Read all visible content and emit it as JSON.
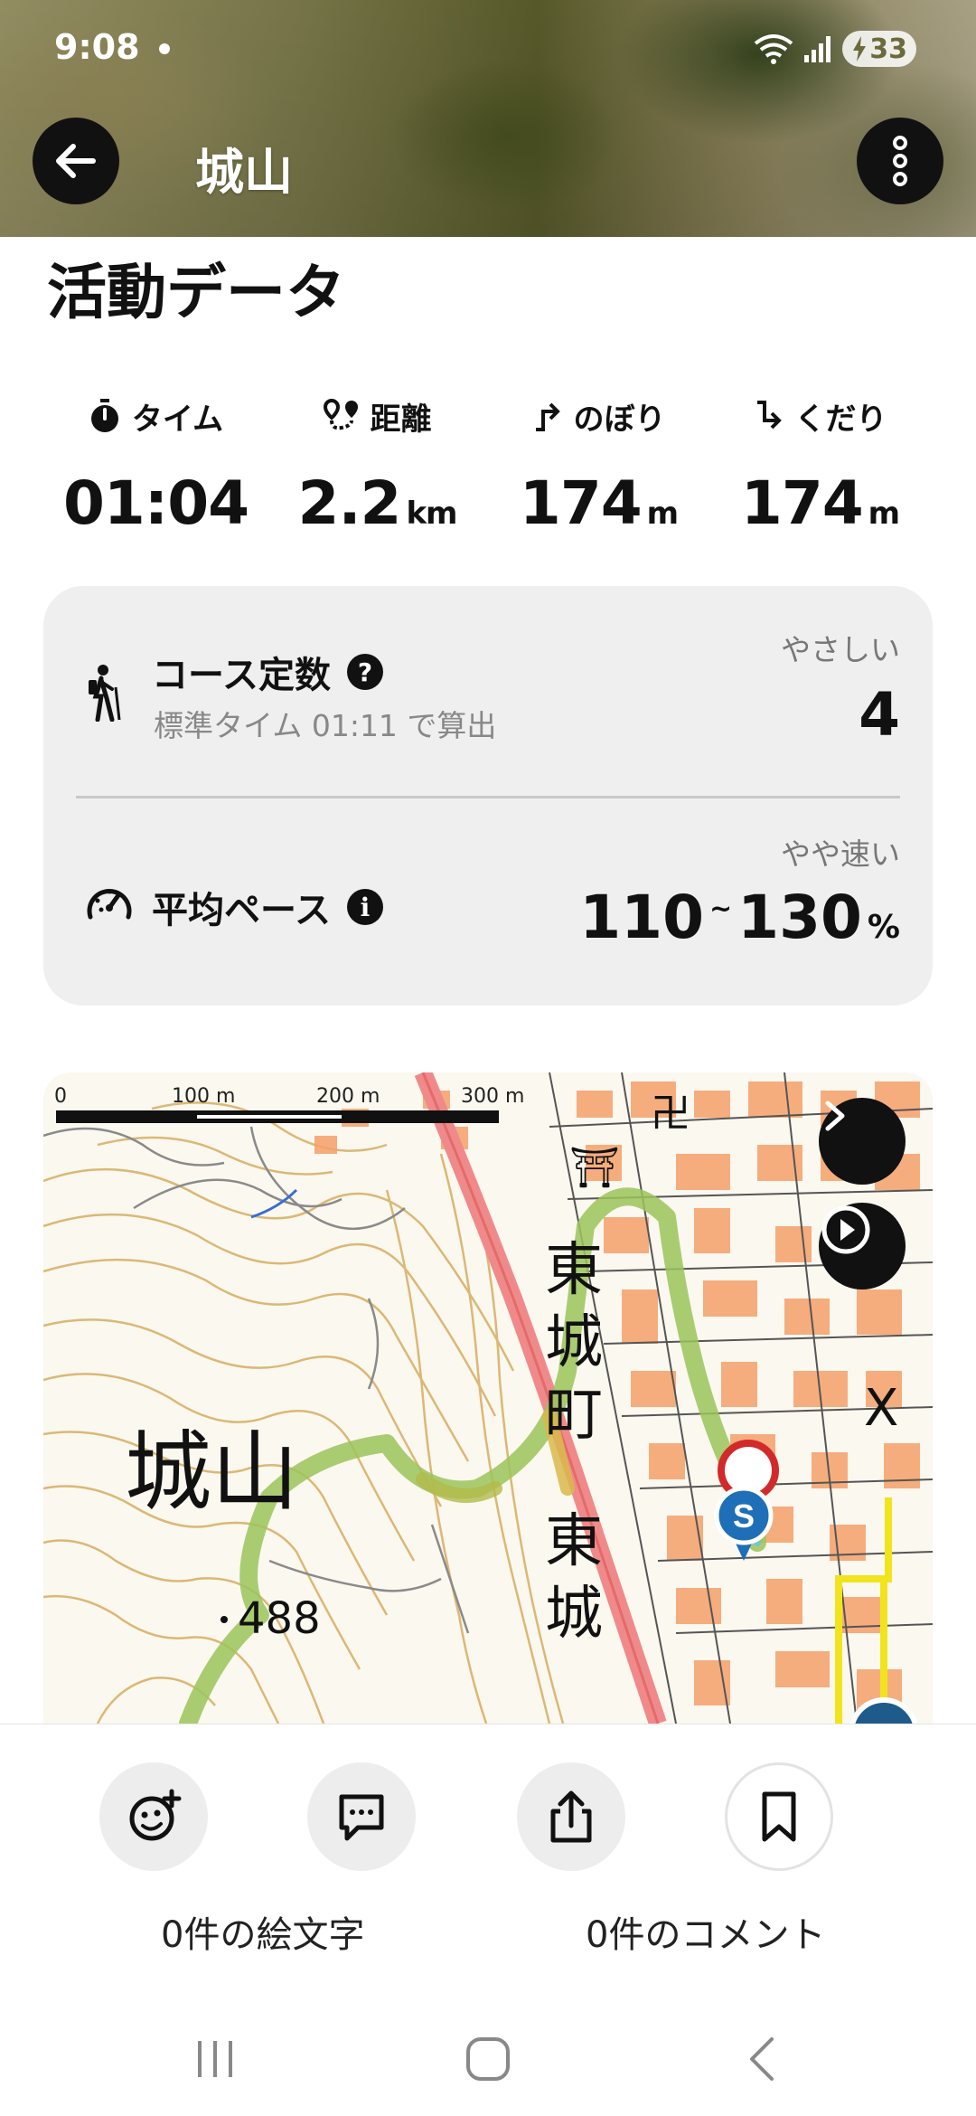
{
  "status_bar": {
    "time": "9:08",
    "battery": "33"
  },
  "header": {
    "title": "城山"
  },
  "activity": {
    "section_title": "活動データ",
    "stats": [
      {
        "label": "タイム",
        "icon": "stopwatch-icon",
        "value": "01:04",
        "unit": ""
      },
      {
        "label": "距離",
        "icon": "route-icon",
        "value": "2.2",
        "unit": "km"
      },
      {
        "label": "のぼり",
        "icon": "ascent-icon",
        "value": "174",
        "unit": "m"
      },
      {
        "label": "くだり",
        "icon": "descent-icon",
        "value": "174",
        "unit": "m"
      }
    ]
  },
  "course_card": {
    "course_constant": {
      "title": "コース定数",
      "subtitle": "標準タイム 01:11 で算出",
      "rating": "やさしい",
      "value": "4"
    },
    "average_pace": {
      "title": "平均ペース",
      "rating": "やや速い",
      "min": "110",
      "tilde": "~",
      "max": "130",
      "unit": "%"
    }
  },
  "map": {
    "scale_labels": [
      "0",
      "100 m",
      "200 m",
      "300 m"
    ],
    "place_labels": {
      "mountain": "城山",
      "elevation": "488",
      "town": [
        "東",
        "城",
        "町"
      ],
      "town2": [
        "東",
        "城"
      ],
      "shrine": "卍",
      "school": "X"
    },
    "start_marker": "S",
    "track_color": "#9bc45a",
    "road_color": "#f08a8a"
  },
  "actions": {
    "emoji_count": "0件の絵文字",
    "comment_count": "0件のコメント"
  }
}
